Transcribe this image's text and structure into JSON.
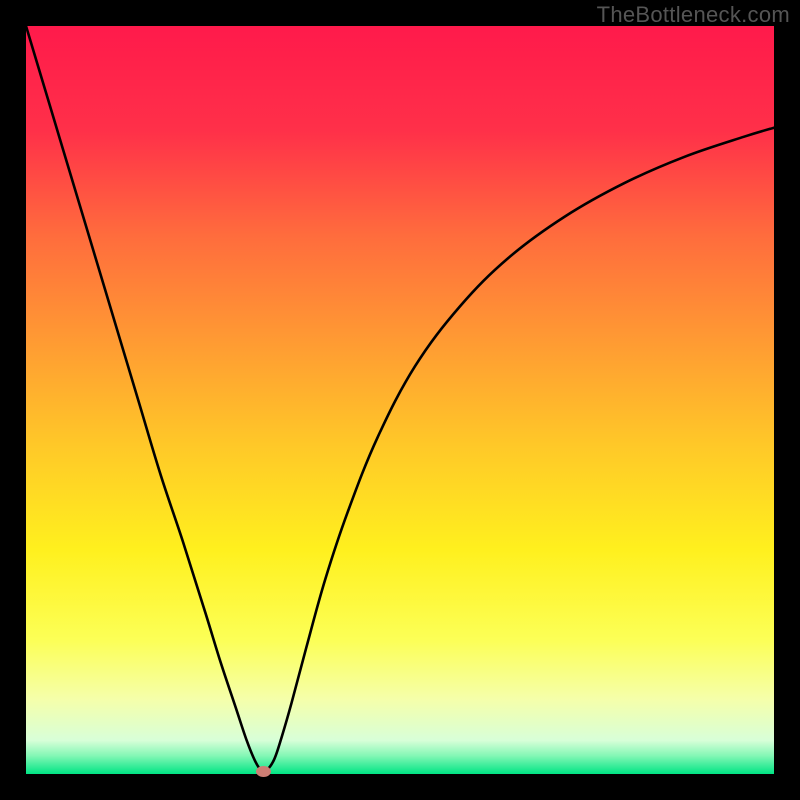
{
  "watermark": "TheBottleneck.com",
  "chart_data": {
    "type": "line",
    "title": "",
    "xlabel": "",
    "ylabel": "",
    "xlim": [
      0,
      100
    ],
    "ylim": [
      0,
      100
    ],
    "grid": false,
    "background_gradient": {
      "stops": [
        {
          "pos": 0.0,
          "color": "#ff1a4b"
        },
        {
          "pos": 0.14,
          "color": "#ff3049"
        },
        {
          "pos": 0.28,
          "color": "#ff6c3d"
        },
        {
          "pos": 0.42,
          "color": "#ff9a33"
        },
        {
          "pos": 0.56,
          "color": "#ffc828"
        },
        {
          "pos": 0.7,
          "color": "#fff01e"
        },
        {
          "pos": 0.82,
          "color": "#fcff56"
        },
        {
          "pos": 0.9,
          "color": "#f5ffaa"
        },
        {
          "pos": 0.955,
          "color": "#d8ffd8"
        },
        {
          "pos": 0.975,
          "color": "#86f7b6"
        },
        {
          "pos": 1.0,
          "color": "#00e584"
        }
      ]
    },
    "series": [
      {
        "name": "bottleneck-curve",
        "color": "#000000",
        "width": 2.6,
        "x": [
          0.0,
          3,
          6,
          9,
          12,
          15,
          18,
          21,
          24,
          26,
          28,
          29.5,
          30.6,
          31.4,
          32.2,
          33.2,
          34.2,
          35.5,
          37.5,
          40,
          43,
          47,
          52,
          58,
          64.5,
          72,
          80,
          88,
          96,
          100
        ],
        "y": [
          100,
          90,
          80,
          70,
          60,
          50,
          40,
          31,
          21.5,
          15,
          9,
          4.5,
          1.8,
          0.55,
          0.55,
          2.0,
          5.0,
          9.5,
          17,
          26,
          35,
          45,
          54.5,
          62.5,
          69,
          74.5,
          79,
          82.5,
          85.2,
          86.4
        ]
      }
    ],
    "marker": {
      "x": 31.8,
      "y": 0.3,
      "color": "#cd7e74"
    }
  }
}
